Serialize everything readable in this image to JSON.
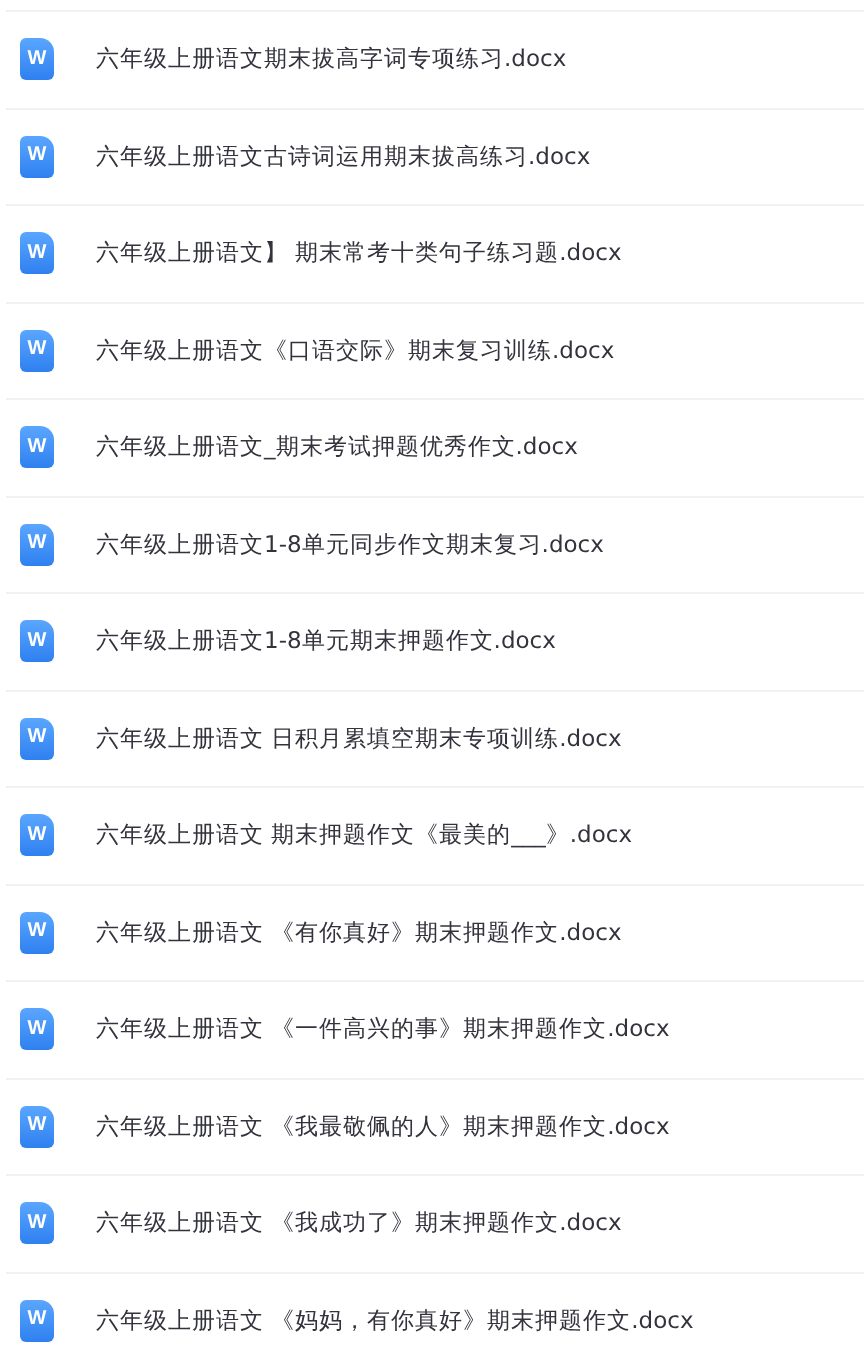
{
  "files": [
    {
      "icon_letter": "W",
      "name": "六年级上册语文期末拔高字词专项练习.docx"
    },
    {
      "icon_letter": "W",
      "name": "六年级上册语文古诗词运用期末拔高练习.docx"
    },
    {
      "icon_letter": "W",
      "name": "六年级上册语文】 期末常考十类句子练习题.docx"
    },
    {
      "icon_letter": "W",
      "name": "六年级上册语文《口语交际》期末复习训练.docx"
    },
    {
      "icon_letter": "W",
      "name": "六年级上册语文_期末考试押题优秀作文.docx"
    },
    {
      "icon_letter": "W",
      "name": "六年级上册语文1-8单元同步作文期末复习.docx"
    },
    {
      "icon_letter": "W",
      "name": "六年级上册语文1-8单元期末押题作文.docx"
    },
    {
      "icon_letter": "W",
      "name": "六年级上册语文 日积月累填空期末专项训练.docx"
    },
    {
      "icon_letter": "W",
      "name": "六年级上册语文 期末押题作文《最美的___》.docx"
    },
    {
      "icon_letter": "W",
      "name": "六年级上册语文 《有你真好》期末押题作文.docx"
    },
    {
      "icon_letter": "W",
      "name": "六年级上册语文 《一件高兴的事》期末押题作文.docx"
    },
    {
      "icon_letter": "W",
      "name": "六年级上册语文 《我最敬佩的人》期末押题作文.docx"
    },
    {
      "icon_letter": "W",
      "name": "六年级上册语文 《我成功了》期末押题作文.docx"
    },
    {
      "icon_letter": "W",
      "name": "六年级上册语文 《妈妈，有你真好》期末押题作文.docx"
    }
  ]
}
